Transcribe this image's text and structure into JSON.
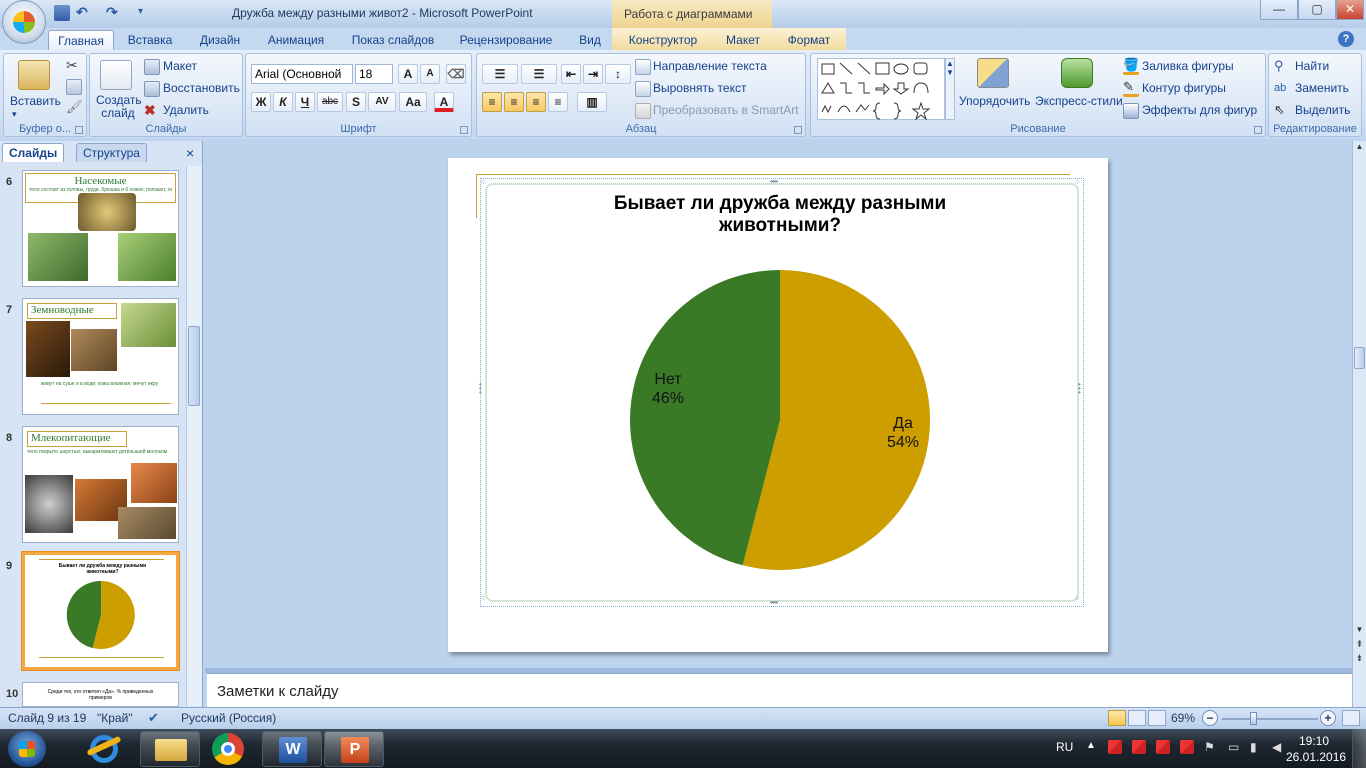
{
  "window": {
    "title": "Дружба между разными живот2 - Microsoft PowerPoint",
    "context_tab": "Работа с диаграммами",
    "btn_min": "—",
    "btn_max": "▢",
    "btn_close": "✕"
  },
  "tabs": [
    "Главная",
    "Вставка",
    "Дизайн",
    "Анимация",
    "Показ слайдов",
    "Рецензирование",
    "Вид",
    "Конструктор",
    "Макет",
    "Формат"
  ],
  "help": "?",
  "ribbon": {
    "clipboard": {
      "paste": "Вставить",
      "label": "Буфер о..."
    },
    "slides": {
      "new_slide": "Создать слайд",
      "layout": "Макет",
      "reset": "Восстановить",
      "delete": "Удалить",
      "label": "Слайды"
    },
    "font": {
      "name": "Arial (Основной",
      "size": "18",
      "bold": "Ж",
      "italic": "К",
      "underline": "Ч",
      "strike": "abc",
      "shadow": "S",
      "spacing": "AV",
      "case": "Aa",
      "color": "A",
      "grow": "A",
      "shrink": "A",
      "label": "Шрифт"
    },
    "paragraph": {
      "text_direction": "Направление текста",
      "align_text": "Выровнять текст",
      "smartart": "Преобразовать в SmartArt",
      "label": "Абзац"
    },
    "drawing": {
      "arrange": "Упорядочить",
      "quick_styles": "Экспресс-стили",
      "fill": "Заливка фигуры",
      "outline": "Контур фигуры",
      "effects": "Эффекты для фигур",
      "label": "Рисование"
    },
    "editing": {
      "find": "Найти",
      "replace": "Заменить",
      "select": "Выделить",
      "label": "Редактирование"
    }
  },
  "panel": {
    "tab_slides": "Слайды",
    "tab_outline": "Структура",
    "close": "×",
    "slides": [
      {
        "num": "6",
        "title": "Насекомые",
        "text": "тело состоит из головы, груди, брюшка и 6 ножек; ползают, летают"
      },
      {
        "num": "7",
        "title": "Земноводные",
        "text": "живут на суше и в воде; кожа влажная; мечут икру"
      },
      {
        "num": "8",
        "title": "Млекопитающие",
        "text": "тело покрыто шерстью; выкармливают детёнышей молоком"
      },
      {
        "num": "9",
        "title": "Бывает ли дружба между разными животными?",
        "text": ""
      },
      {
        "num": "10",
        "title": "Среди тех, кто ответил «Да», % приведенных примеров",
        "text": ""
      }
    ]
  },
  "chart_data": {
    "type": "pie",
    "title": "Бывает ли дружба между разными животными?",
    "title_line1": "Бывает ли дружба между разными",
    "title_line2": "животными?",
    "categories": [
      "Да",
      "Нет"
    ],
    "values": [
      54,
      46
    ],
    "labels": [
      "54%",
      "46%"
    ],
    "colors": [
      "#cc9e00",
      "#3a7a26"
    ]
  },
  "notes": "Заметки к слайду",
  "status": {
    "slide": "Слайд 9 из 19",
    "theme": "\"Край\"",
    "lang": "Русский (Россия)",
    "zoom": "69%",
    "minus": "−",
    "plus": "+"
  },
  "taskbar": {
    "lang": "RU",
    "time": "19:10",
    "date": "26.01.2016"
  }
}
